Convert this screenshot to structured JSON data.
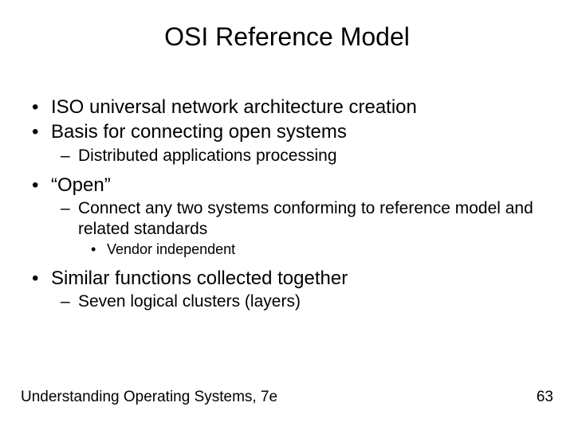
{
  "title": "OSI Reference Model",
  "bullets": {
    "b1": "ISO universal network architecture creation",
    "b2": "Basis for connecting open systems",
    "b2a": "Distributed applications processing",
    "b3": "“Open”",
    "b3a": "Connect any two systems conforming to reference model and related standards",
    "b3a1": "Vendor independent",
    "b4": "Similar functions collected together",
    "b4a": "Seven logical clusters (layers)"
  },
  "footer": {
    "left": "Understanding Operating Systems, 7e",
    "right": "63"
  }
}
